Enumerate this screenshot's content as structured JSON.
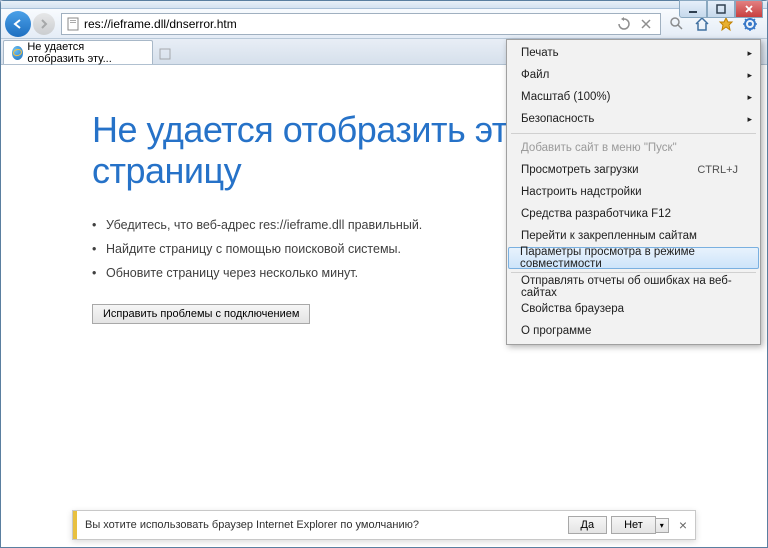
{
  "address": "res://ieframe.dll/dnserror.htm",
  "tab_title": "Не удается отобразить эту...",
  "page": {
    "heading_l1": "Не удается отобразить эту",
    "heading_l2": "страницу",
    "bullets": [
      "Убедитесь, что веб-адрес res://ieframe.dll правильный.",
      "Найдите страницу с помощью поисковой системы.",
      "Обновите страницу через несколько минут."
    ],
    "fix_button": "Исправить проблемы с подключением"
  },
  "menu": {
    "print": "Печать",
    "file": "Файл",
    "zoom": "Масштаб (100%)",
    "safety": "Безопасность",
    "add_to_start": "Добавить сайт в меню \"Пуск\"",
    "view_downloads": "Просмотреть загрузки",
    "shortcut_downloads": "CTRL+J",
    "addons": "Настроить надстройки",
    "f12": "Средства разработчика F12",
    "pinned": "Перейти к закрепленным сайтам",
    "compat": "Параметры просмотра в режиме совместимости",
    "report": "Отправлять отчеты об ошибках на веб-сайтах",
    "options": "Свойства браузера",
    "about": "О программе"
  },
  "infobar": {
    "text": "Вы хотите использовать браузер Internet Explorer по умолчанию?",
    "yes": "Да",
    "no": "Нет"
  }
}
